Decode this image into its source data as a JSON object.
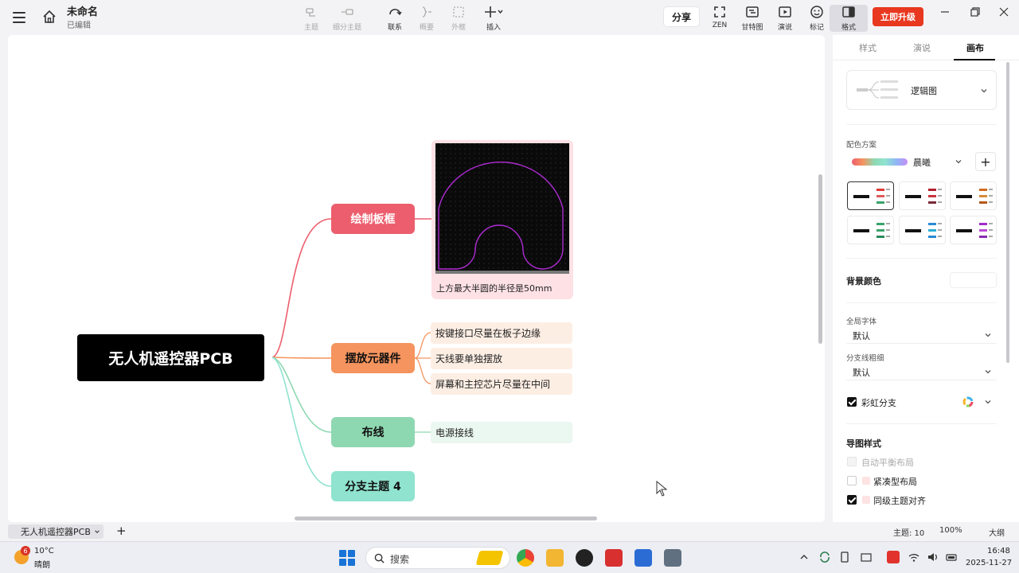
{
  "doc": {
    "title": "未命名",
    "status": "已编辑"
  },
  "toolbar": {
    "topic": "主题",
    "subtopic": "细分主题",
    "relation": "联系",
    "summary": "概要",
    "boundary": "外框",
    "insert": "插入",
    "share": "分享",
    "zen": "ZEN",
    "gantt": "甘特图",
    "present": "演说",
    "mark": "标记",
    "format": "格式",
    "upgrade": "立即升级"
  },
  "map": {
    "root": "无人机遥控器PCB",
    "branches": [
      {
        "label": "绘制板框",
        "color": "#ec5e6d",
        "image_caption": "上方最大半圆的半径是50mm"
      },
      {
        "label": "摆放元器件",
        "color": "#f5945e",
        "leaves": [
          "按键接口尽量在板子边缘",
          "天线要单独摆放",
          "屏幕和主控芯片尽量在中间"
        ]
      },
      {
        "label": "布线",
        "color": "#8ed8b1",
        "leaves": [
          "电源接线"
        ]
      },
      {
        "label": "分支主题 4",
        "color": "#8fe3cf"
      }
    ]
  },
  "panel": {
    "tabs": [
      "样式",
      "演说",
      "画布"
    ],
    "active_tab": "画布",
    "layout": "逻辑图",
    "color_scheme_label": "配色方案",
    "color_scheme": "晨曦",
    "bg_color_label": "背景颜色",
    "font_label": "全局字体",
    "font_value": "默认",
    "branch_width_label": "分支线粗细",
    "branch_width_value": "默认",
    "rainbow_label": "彩虹分支",
    "map_style_label": "导图样式",
    "auto_balance": "自动平衡布局",
    "compact": "紧凑型布局",
    "align_same_level": "同级主题对齐"
  },
  "sheet": {
    "tab": "无人机遥控器PCB",
    "topic_count": "主题: 10",
    "zoom": "100%",
    "view": "大纲"
  },
  "taskbar": {
    "weather_temp": "10°C",
    "weather_desc": "晴朗",
    "weather_badge": "6",
    "search": "搜索",
    "time": "16:48",
    "date": "2025-11-27"
  }
}
